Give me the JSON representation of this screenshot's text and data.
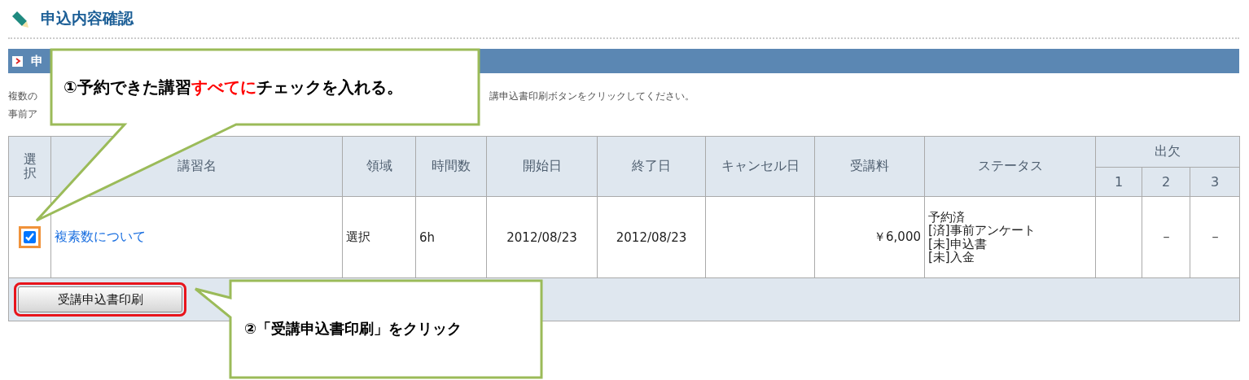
{
  "page": {
    "title": "申込内容確認"
  },
  "section": {
    "title": "申"
  },
  "intro": {
    "line_1": [
      "複数の",
      "講申込書印刷ボタンをクリックしてください。"
    ],
    "line_2": "事前ア"
  },
  "table": {
    "columns": [
      "選択",
      "講習名",
      "領域",
      "時間数",
      "開始日",
      "終了日",
      "キャンセル日",
      "受講料",
      "ステータス"
    ],
    "attendance": {
      "label": "出欠",
      "columns": [
        "1",
        "2",
        "3"
      ]
    },
    "rows": [
      {
        "checked": true,
        "highlighted": true,
        "course": "複素数について",
        "area": "選択",
        "hours": "6h",
        "start": "2012/08/23",
        "end": "2012/08/23",
        "fee": "￥6,000",
        "status": [
          "予約済",
          "[済]事前アンケート",
          "[未]申込書",
          "[未]入金"
        ],
        "attendance_2": "－",
        "attendance_3": "－"
      }
    ]
  },
  "print_button": {
    "label": "受講申込書印刷",
    "highlighted": true
  },
  "callouts": [
    {
      "parts": [
        {
          "text": "①予約できた講習",
          "emphasis": false
        },
        {
          "text": "すべてに",
          "emphasis": true
        },
        {
          "text": "チェックを入れる。",
          "emphasis": false
        }
      ]
    },
    {
      "parts": [
        {
          "text": "②「受講申込書印刷」をクリック",
          "emphasis": false
        }
      ]
    }
  ]
}
